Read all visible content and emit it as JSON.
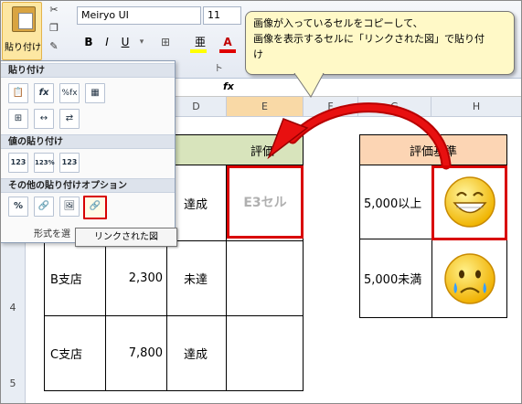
{
  "ribbon": {
    "paste_label": "貼り付け",
    "font_name": "Meiryo UI",
    "font_size": "11",
    "bold": "B",
    "italic": "I",
    "underline": "U",
    "grow_font": "A",
    "shrink_font": "A",
    "font_color": "A",
    "fill_label": "亜",
    "group_label": "ト"
  },
  "formula_bar": {
    "fx": "fx"
  },
  "columns": [
    "D",
    "E",
    "F",
    "G",
    "H"
  ],
  "rows": [
    "4",
    "5"
  ],
  "paste_menu": {
    "section_paste": "貼り付け",
    "section_values": "値の貼り付け",
    "section_other": "その他の貼り付けオプション",
    "format_label": "形式を選",
    "paste_icons": [
      "clipboard-icon",
      "formula-paste-icon",
      "formula-number-format-icon",
      "keep-source-format-icon",
      "no-borders-icon",
      "keep-column-width-icon",
      "transpose-icon"
    ],
    "value_icons": [
      "123",
      "123%",
      "123"
    ],
    "other_icons": [
      "%",
      "link-icon",
      "picture-icon",
      "linked-picture-icon"
    ]
  },
  "tooltip": "リンクされた図",
  "callout": {
    "line1": "画像が入っているセルをコピーして、",
    "line2": "画像を表示するセルに「リンクされた図」で貼り付",
    "line3": "け"
  },
  "table": {
    "header": "評価",
    "rows": [
      {
        "store": "",
        "amount": "",
        "status": "達成",
        "eval": "E3セル"
      },
      {
        "store": "B支店",
        "amount": "2,300",
        "status": "未達",
        "eval": ""
      },
      {
        "store": "C支店",
        "amount": "7,800",
        "status": "達成",
        "eval": ""
      }
    ]
  },
  "criteria": {
    "header": "評価基準",
    "rows": [
      {
        "threshold": "5,000以上",
        "emoji": "grinning-face"
      },
      {
        "threshold": "5,000未満",
        "emoji": "crying-face"
      }
    ]
  },
  "colors": {
    "accent_red": "#d90000",
    "header_green": "#d8e4bc",
    "header_orange": "#fcd5b4",
    "callout_yellow": "#fff9c7"
  }
}
